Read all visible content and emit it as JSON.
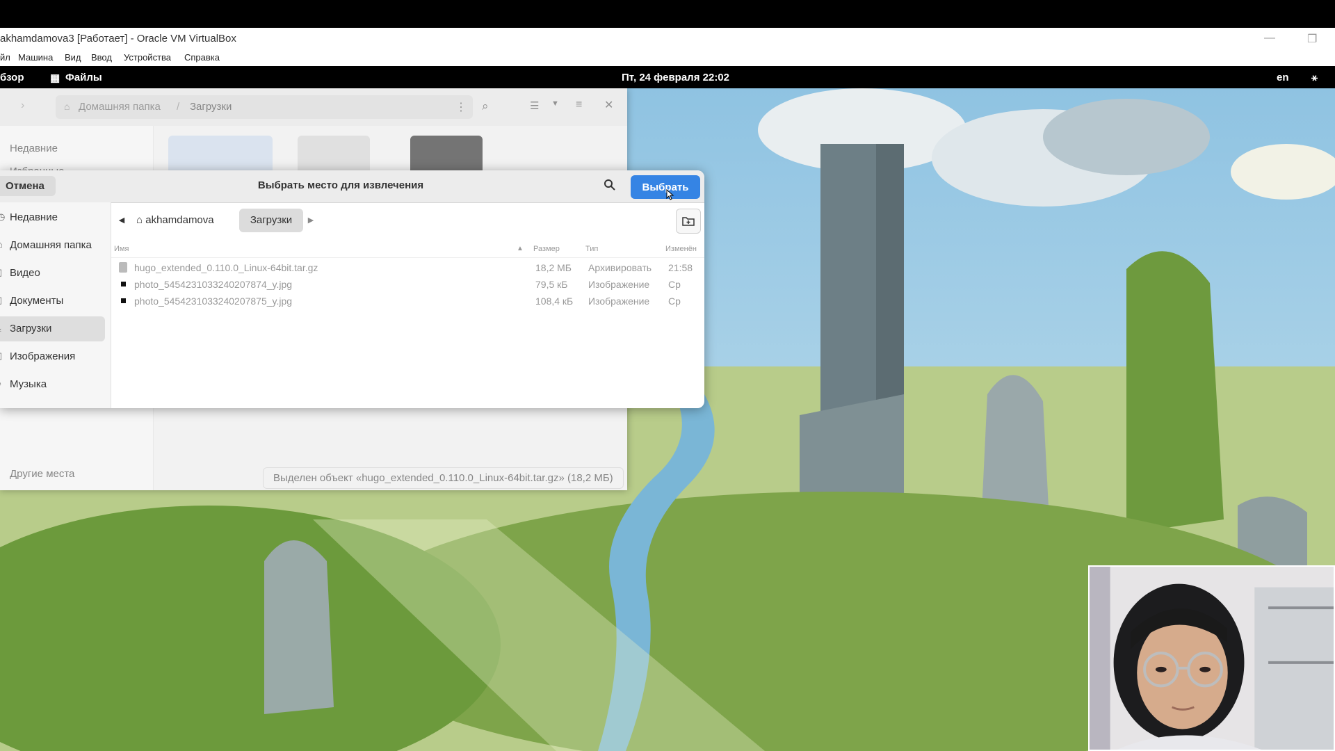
{
  "host": {
    "title": "akhamdamova3 [Работает] - Oracle VM VirtualBox",
    "menu": [
      "йл",
      "Машина",
      "Вид",
      "Ввод",
      "Устройства",
      "Справка"
    ]
  },
  "gnome_bar": {
    "activities": "бзор",
    "app": "Файлы",
    "clock": "Пт, 24 февраля  22:02",
    "lang": "en"
  },
  "files_window": {
    "path": [
      "Домашняя папка",
      "Загрузки"
    ],
    "sidebar": [
      "Недавние",
      "Избранные",
      "Другие места"
    ],
    "status": "Выделен объект «hugo_extended_0.110.0_Linux-64bit.tar.gz» (18,2 МБ)"
  },
  "dialog": {
    "cancel": "Отмена",
    "title": "Выбрать место для извлечения",
    "select": "Выбрать",
    "sidebar": [
      "Недавние",
      "Домашняя папка",
      "Видео",
      "Документы",
      "Загрузки",
      "Изображения",
      "Музыка"
    ],
    "path": {
      "home": "akhamdamova",
      "current": "Загрузки"
    },
    "columns": {
      "name": "Имя",
      "size": "Размер",
      "type": "Тип",
      "modified": "Изменён"
    },
    "files": [
      {
        "name": "hugo_extended_0.110.0_Linux-64bit.tar.gz",
        "size": "18,2 МБ",
        "type": "Архивировать",
        "modified": "21:58"
      },
      {
        "name": "photo_5454231033240207874_y.jpg",
        "size": "79,5 кБ",
        "type": "Изображение",
        "modified": "Ср"
      },
      {
        "name": "photo_5454231033240207875_y.jpg",
        "size": "108,4 кБ",
        "type": "Изображение",
        "modified": "Ср"
      }
    ]
  },
  "colors": {
    "accent": "#3584e4",
    "sky": "#a9cfe6",
    "grass": "#8fb05a"
  }
}
